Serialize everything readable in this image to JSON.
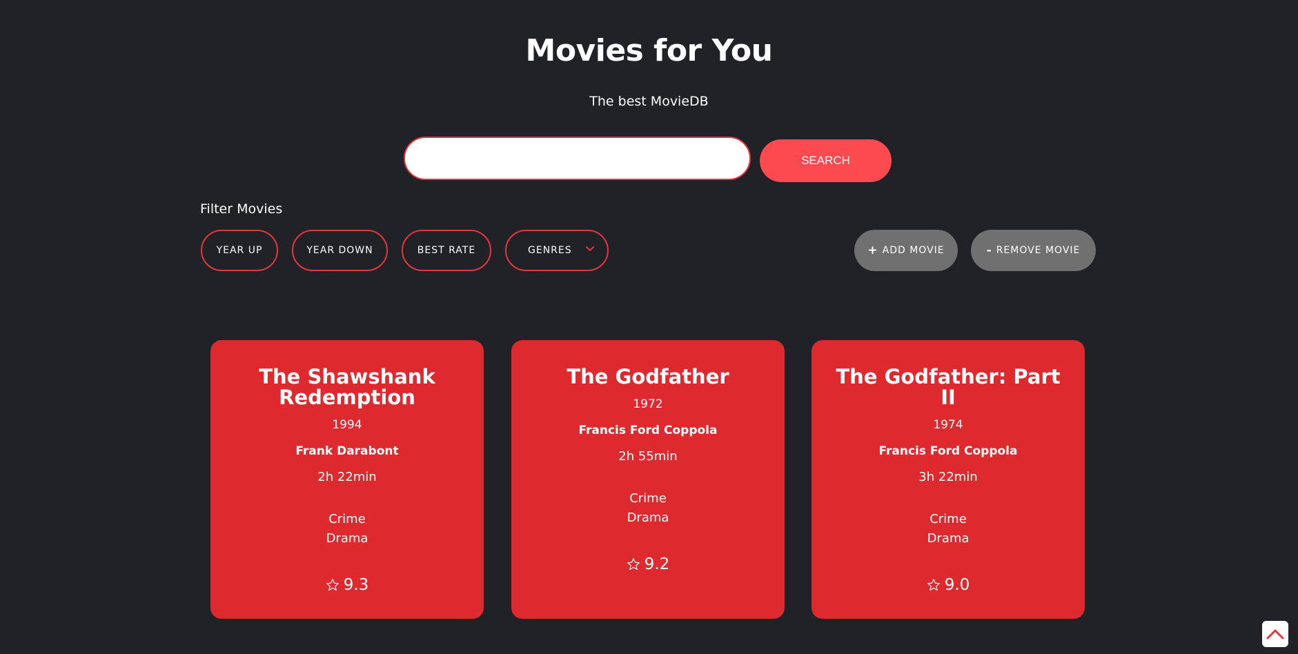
{
  "header": {
    "title": "Movies for You",
    "subtitle": "The best MovieDB"
  },
  "search": {
    "value": "",
    "placeholder": "",
    "button_label": "SEARCH"
  },
  "filters": {
    "label": "Filter Movies",
    "year_up": "YEAR UP",
    "year_down": "YEAR DOWN",
    "best_rate": "BEST RATE",
    "genres": "GENRES"
  },
  "actions": {
    "add_symbol": "+",
    "add_label": "ADD MOVIE",
    "remove_symbol": "-",
    "remove_label": "REMOVE MOVIE"
  },
  "movies": [
    {
      "title": "The Shawshank Redemption",
      "year": "1994",
      "director": "Frank Darabont",
      "duration": "2h 22min",
      "genres": [
        "Crime",
        "Drama"
      ],
      "rating": "9.3"
    },
    {
      "title": "The Godfather",
      "year": "1972",
      "director": "Francis Ford Coppola",
      "duration": "2h 55min",
      "genres": [
        "Crime",
        "Drama"
      ],
      "rating": "9.2"
    },
    {
      "title": "The Godfather: Part II",
      "year": "1974",
      "director": "Francis Ford Coppola",
      "duration": "3h 22min",
      "genres": [
        "Crime",
        "Drama"
      ],
      "rating": "9.0"
    }
  ],
  "icons": {
    "rating": "star-outline-icon",
    "genres_dropdown": "chevron-down-icon",
    "scroll_top": "chevron-up-icon"
  },
  "colors": {
    "background": "#202227",
    "accent": "#e7363c",
    "search_button": "#fc4a50",
    "card": "#de2a2f",
    "grey_button": "#707071"
  }
}
